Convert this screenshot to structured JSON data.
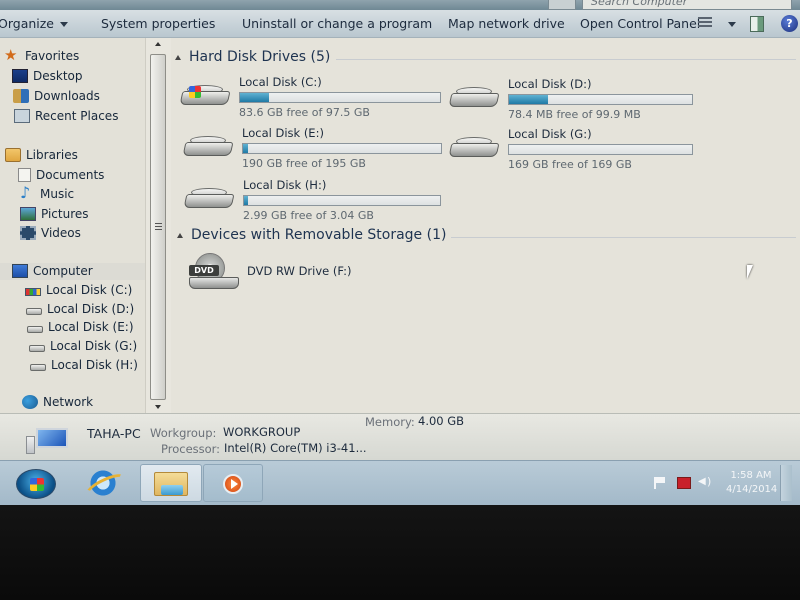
{
  "window": {
    "search_placeholder": "Search Computer"
  },
  "command_bar": {
    "organize_label": "Organize",
    "system_properties_label": "System properties",
    "uninstall_label": "Uninstall or change a program",
    "map_network_drive_label": "Map network drive",
    "open_control_panel_label": "Open Control Panel",
    "views_icon": "change-view-icon",
    "preview_pane_icon": "preview-pane-icon",
    "help_icon": "help-icon",
    "help_glyph": "?"
  },
  "nav_pane": {
    "favorites": {
      "label": "Favorites",
      "items": [
        {
          "label": "Desktop",
          "icon": "desktop-icon"
        },
        {
          "label": "Downloads",
          "icon": "downloads-icon"
        },
        {
          "label": "Recent Places",
          "icon": "recent-places-icon"
        }
      ]
    },
    "libraries": {
      "label": "Libraries",
      "items": [
        {
          "label": "Documents",
          "icon": "documents-icon"
        },
        {
          "label": "Music",
          "icon": "music-icon"
        },
        {
          "label": "Pictures",
          "icon": "pictures-icon"
        },
        {
          "label": "Videos",
          "icon": "videos-icon"
        }
      ]
    },
    "computer": {
      "label": "Computer",
      "items": [
        {
          "label": "Local Disk (C:)",
          "icon": "system-drive-icon"
        },
        {
          "label": "Local Disk (D:)",
          "icon": "drive-icon"
        },
        {
          "label": "Local Disk (E:)",
          "icon": "drive-icon"
        },
        {
          "label": "Local Disk (G:)",
          "icon": "drive-icon"
        },
        {
          "label": "Local Disk (H:)",
          "icon": "drive-icon"
        }
      ]
    },
    "network": {
      "label": "Network"
    }
  },
  "content": {
    "hard_disk_group": {
      "title": "Hard Disk Drives (5)",
      "drives": [
        {
          "name": "Local Disk (C:)",
          "free_text": "83.6 GB free of 97.5 GB",
          "used_fraction": 0.143,
          "system": true
        },
        {
          "name": "Local Disk (D:)",
          "free_text": "78.4 MB free of 99.9 MB",
          "used_fraction": 0.215,
          "system": false
        },
        {
          "name": "Local Disk (E:)",
          "free_text": "190 GB free of 195 GB",
          "used_fraction": 0.026,
          "system": false
        },
        {
          "name": "Local Disk (G:)",
          "free_text": "169 GB free of 169 GB",
          "used_fraction": 0.0,
          "system": false
        },
        {
          "name": "Local Disk (H:)",
          "free_text": "2.99 GB free of 3.04 GB",
          "used_fraction": 0.016,
          "system": false
        }
      ]
    },
    "removable_group": {
      "title": "Devices with Removable Storage (1)",
      "devices": [
        {
          "name": "DVD RW Drive (F:)",
          "badge": "DVD"
        }
      ]
    },
    "bar_fill_color": "#1f7aa6"
  },
  "details_pane": {
    "computer_name": "TAHA-PC",
    "workgroup_label": "Workgroup:",
    "workgroup_value": "WORKGROUP",
    "memory_label": "Memory:",
    "memory_value": "4.00 GB",
    "processor_label": "Processor:",
    "processor_value": "Intel(R) Core(TM) i3-41..."
  },
  "taskbar": {
    "pinned": [
      {
        "name": "Internet Explorer",
        "icon": "internet-explorer-icon"
      },
      {
        "name": "Windows Explorer",
        "icon": "windows-explorer-icon",
        "active": true
      },
      {
        "name": "Windows Media Player",
        "icon": "media-player-icon"
      }
    ],
    "tray": {
      "time": "1:58 AM",
      "date": "4/14/2014"
    }
  }
}
